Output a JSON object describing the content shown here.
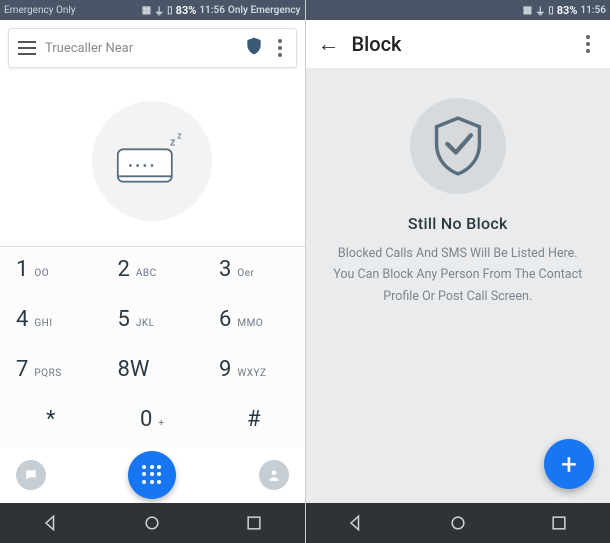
{
  "status": {
    "left_text": "Emergency Only",
    "right_icons": "NFC WiFi",
    "battery": "83%",
    "time": "11:56",
    "extra": "Only Emergency"
  },
  "left": {
    "search_placeholder": "Truecaller Near",
    "keys": [
      {
        "digit": "1",
        "letters": "OO"
      },
      {
        "digit": "2",
        "letters": "ABC"
      },
      {
        "digit": "3",
        "letters": "Oer"
      },
      {
        "digit": "4",
        "letters": "GHI"
      },
      {
        "digit": "5",
        "letters": "JKL"
      },
      {
        "digit": "6",
        "letters": "MMO"
      },
      {
        "digit": "7",
        "letters": "PQRS"
      },
      {
        "digit": "8W",
        "letters": ""
      },
      {
        "digit": "9",
        "letters": "WXYZ"
      },
      {
        "digit": "*",
        "letters": ""
      },
      {
        "digit": "0",
        "letters": "+"
      },
      {
        "digit": "#",
        "letters": ""
      }
    ]
  },
  "right": {
    "title": "Block",
    "heading": "Still No Block",
    "desc": "Blocked Calls And SMS Will Be Listed Here. You Can Block Any Person From The Contact Profile Or Post Call Screen."
  },
  "colors": {
    "accent": "#1976f2"
  }
}
